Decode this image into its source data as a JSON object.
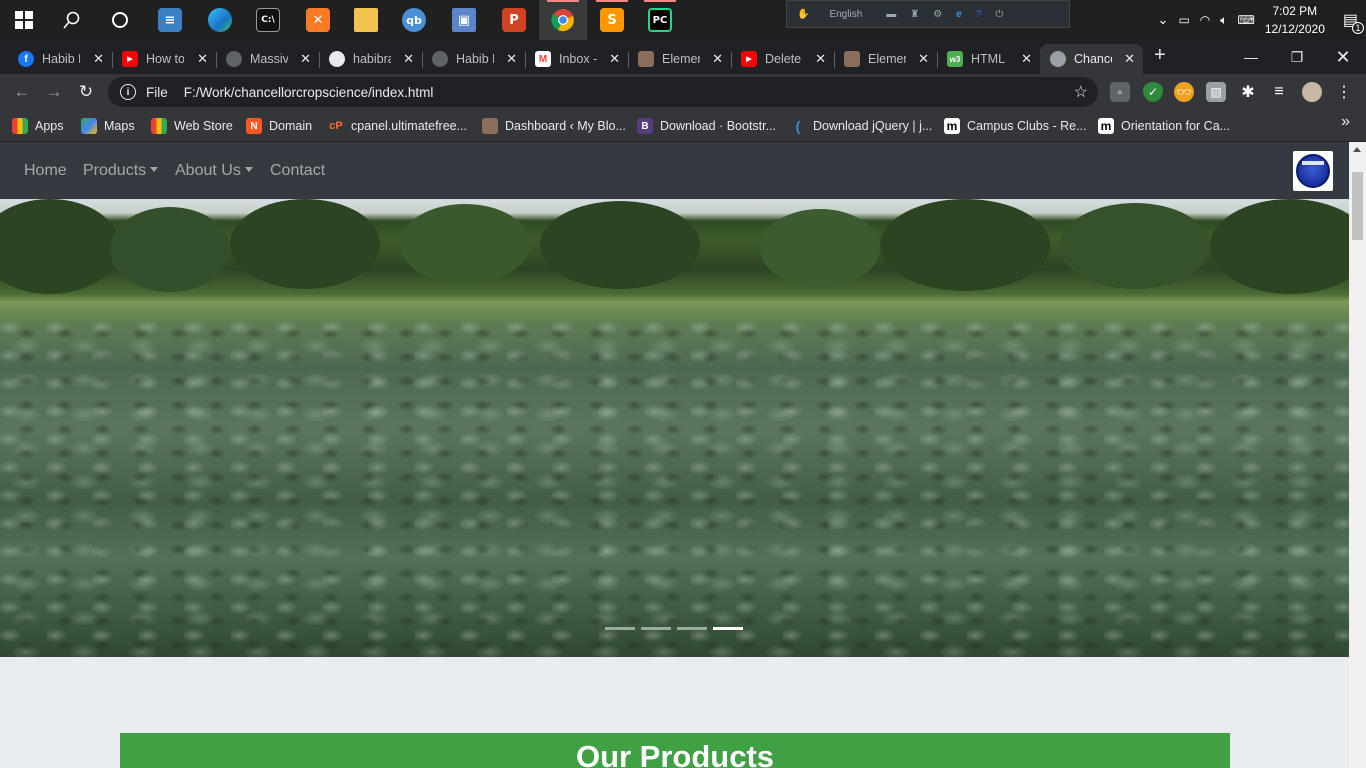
{
  "taskbar": {
    "apps": [
      {
        "icon": "windows-start-icon"
      },
      {
        "icon": "search-icon"
      },
      {
        "icon": "cortana-icon"
      },
      {
        "icon": "task-manager-icon"
      },
      {
        "icon": "edge-icon"
      },
      {
        "icon": "terminal-icon"
      },
      {
        "icon": "xampp-icon"
      },
      {
        "icon": "file-explorer-icon"
      },
      {
        "icon": "qbittorrent-icon",
        "label": "qb"
      },
      {
        "icon": "network-tool-icon"
      },
      {
        "icon": "powerpoint-icon",
        "label": "P"
      },
      {
        "icon": "chrome-icon"
      },
      {
        "icon": "sublime-icon",
        "label": "S"
      },
      {
        "icon": "pycharm-icon",
        "label": "PC"
      }
    ],
    "language": "English",
    "clock_time": "7:02 PM",
    "clock_date": "12/12/2020",
    "notification_count": "1"
  },
  "browser": {
    "tabs": [
      {
        "label": "Habib F",
        "icon": "facebook-icon",
        "color": "#1877f2",
        "glyph": "f"
      },
      {
        "label": "How to",
        "icon": "youtube-icon",
        "color": "#ff0000",
        "glyph": "▶"
      },
      {
        "label": "Massive",
        "icon": "globe-icon",
        "color": "#5f6368",
        "glyph": ""
      },
      {
        "label": "habibra",
        "icon": "github-icon",
        "color": "#24292e",
        "glyph": ""
      },
      {
        "label": "Habib F",
        "icon": "globe-icon",
        "color": "#5f6368",
        "glyph": ""
      },
      {
        "label": "Inbox -",
        "icon": "gmail-icon",
        "color": "#ea4335",
        "glyph": "M"
      },
      {
        "label": "Elemen",
        "icon": "avatar-icon",
        "color": "#8a6d5a",
        "glyph": ""
      },
      {
        "label": "Delete",
        "icon": "youtube-icon",
        "color": "#ff0000",
        "glyph": "▶"
      },
      {
        "label": "Elemen",
        "icon": "avatar-icon",
        "color": "#8a6d5a",
        "glyph": ""
      },
      {
        "label": "HTML I",
        "icon": "w3schools-icon",
        "color": "#4caf50",
        "glyph": "w3"
      },
      {
        "label": "Chance",
        "icon": "globe-icon",
        "color": "#5f6368",
        "glyph": "",
        "active": true
      }
    ],
    "address": {
      "protocol": "File",
      "url": "F:/Work/chancellorcropscience/index.html"
    },
    "bookmarks": [
      {
        "label": "Apps",
        "icon": "apps-grid-icon",
        "color": "#4285f4",
        "glyph": "⋮"
      },
      {
        "label": "Maps",
        "icon": "maps-icon",
        "color": "#34a853",
        "glyph": ""
      },
      {
        "label": "Web Store",
        "icon": "web-store-icon",
        "color": "#ea4335",
        "glyph": ""
      },
      {
        "label": "Domain",
        "icon": "domain-icon",
        "color": "#ff5722",
        "glyph": "N"
      },
      {
        "label": "cpanel.ultimatefree...",
        "icon": "cpanel-icon",
        "color": "#ff6c2c",
        "glyph": "cP"
      },
      {
        "label": "Dashboard ‹ My Blo...",
        "icon": "avatar-icon",
        "color": "#8a6d5a",
        "glyph": ""
      },
      {
        "label": "Download · Bootstr...",
        "icon": "bootstrap-icon",
        "color": "#563d7c",
        "glyph": "B"
      },
      {
        "label": "Download jQuery | j...",
        "icon": "jquery-icon",
        "color": "#0769ad",
        "glyph": "("
      },
      {
        "label": "Campus Clubs - Re...",
        "icon": "m-icon",
        "color": "#000000",
        "glyph": "m"
      },
      {
        "label": "Orientation for Ca...",
        "icon": "m-icon",
        "color": "#000000",
        "glyph": "m"
      }
    ]
  },
  "site": {
    "nav": {
      "home": "Home",
      "products": "Products",
      "about": "About Us",
      "contact": "Contact"
    },
    "carousel": {
      "slide_count": 4,
      "active_slide": 4
    },
    "section_title": "Our Products",
    "section_color": "#3fa044"
  }
}
